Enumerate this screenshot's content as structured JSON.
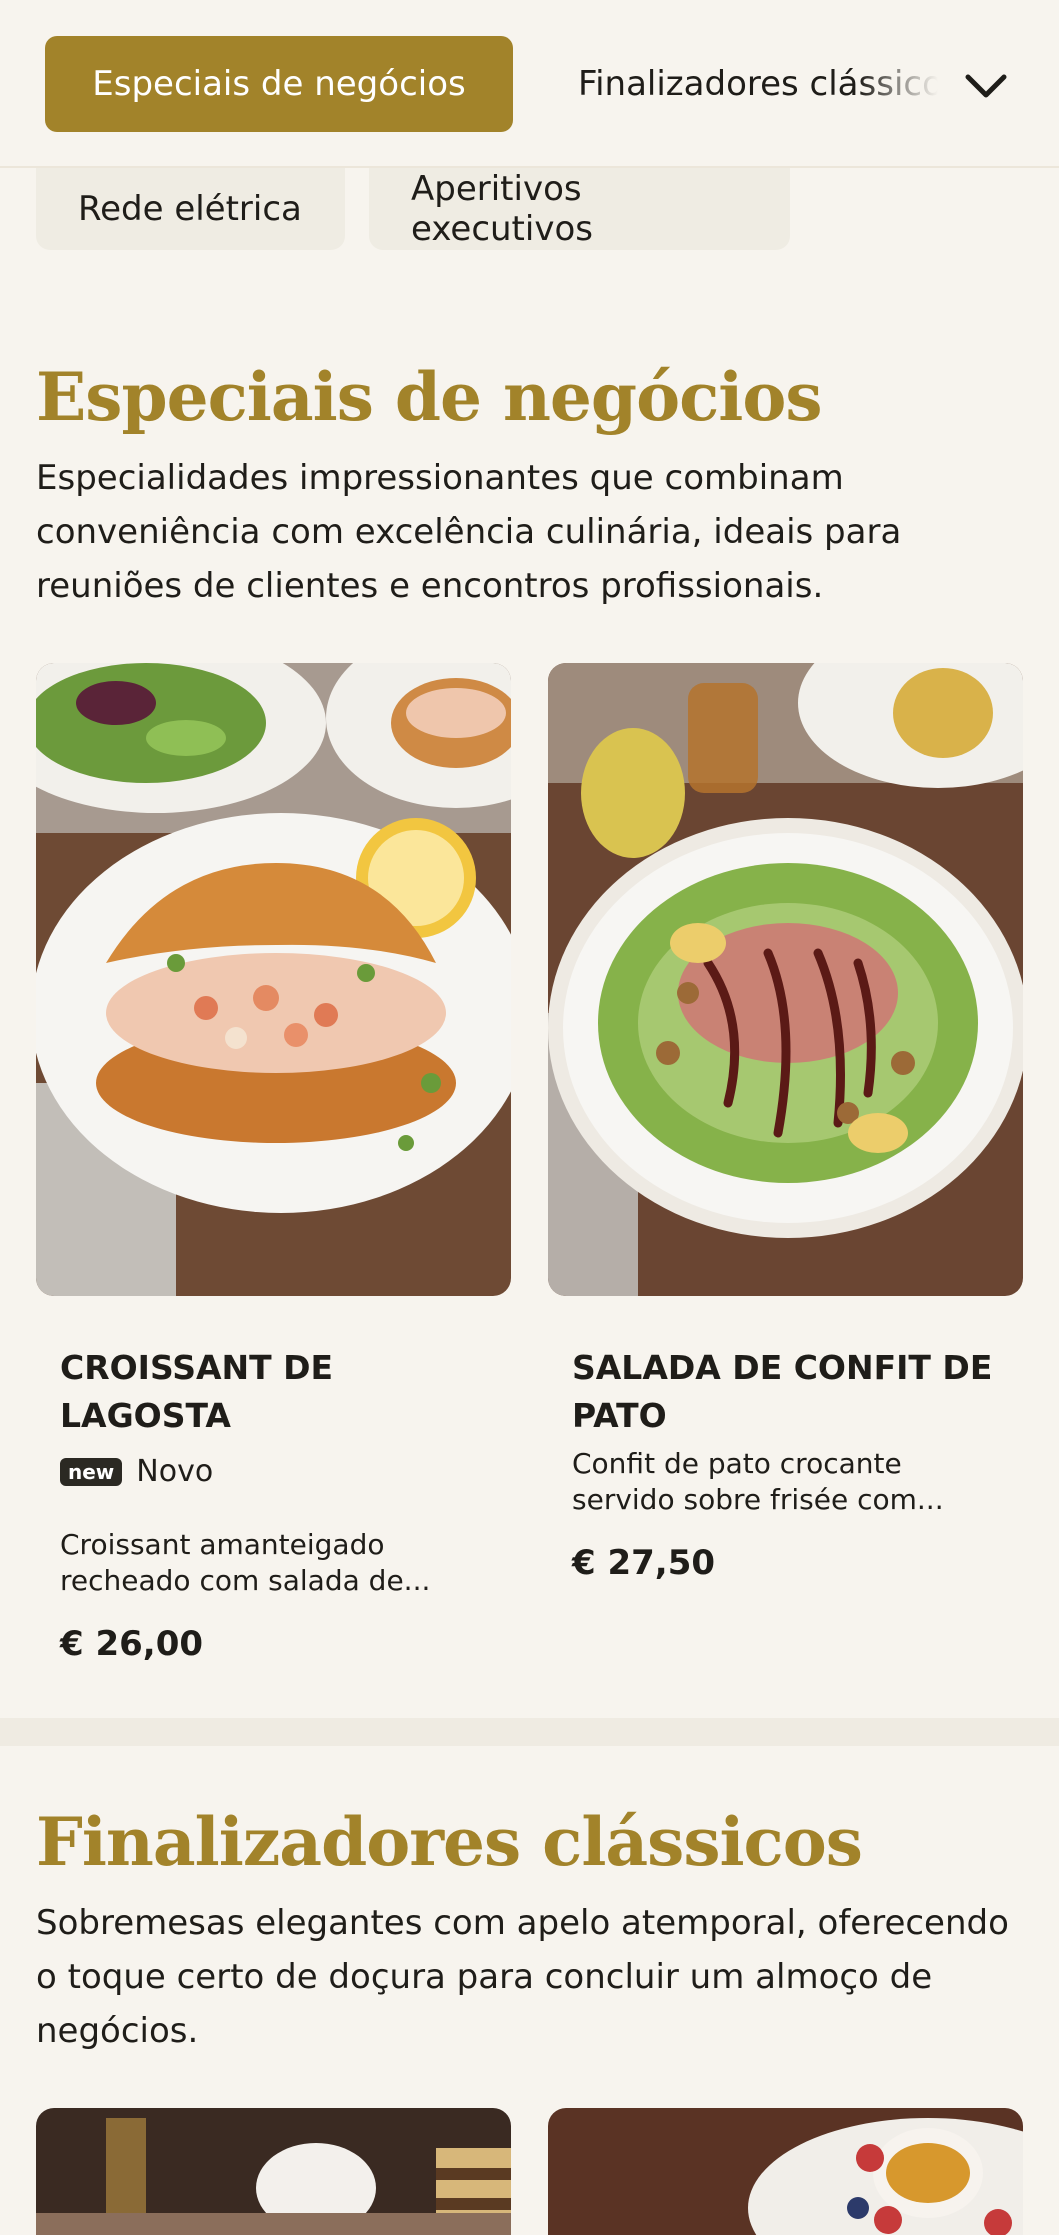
{
  "nav": {
    "active_tab": "Especiais de negócios",
    "next_tab": "Finalizadores clássicos",
    "chips": [
      "Rede elétrica",
      "Aperitivos executivos"
    ]
  },
  "sections": [
    {
      "title": "Especiais de negócios",
      "description": "Especialidades impressionantes que combinam conveniência com excelência culinária, ideais para reuniões de clientes e encontros profissionais.",
      "items": [
        {
          "name": "CROISSANT DE LAGOSTA",
          "badge": "new",
          "badge_label": "Novo",
          "description": "Croissant amanteigado recheado com salada de...",
          "price": "€ 26,00"
        },
        {
          "name": "SALADA DE CONFIT DE PATO",
          "description": "Confit de pato crocante servido sobre frisée com...",
          "price": "€ 27,50"
        }
      ]
    },
    {
      "title": "Finalizadores clássicos",
      "description": "Sobremesas elegantes com apelo atemporal, oferecendo o toque certo de doçura para concluir um almoço de negócios."
    }
  ],
  "colors": {
    "accent": "#a2832a",
    "background": "#f7f4ee",
    "chip": "#efece3",
    "text": "#1f1d19"
  }
}
